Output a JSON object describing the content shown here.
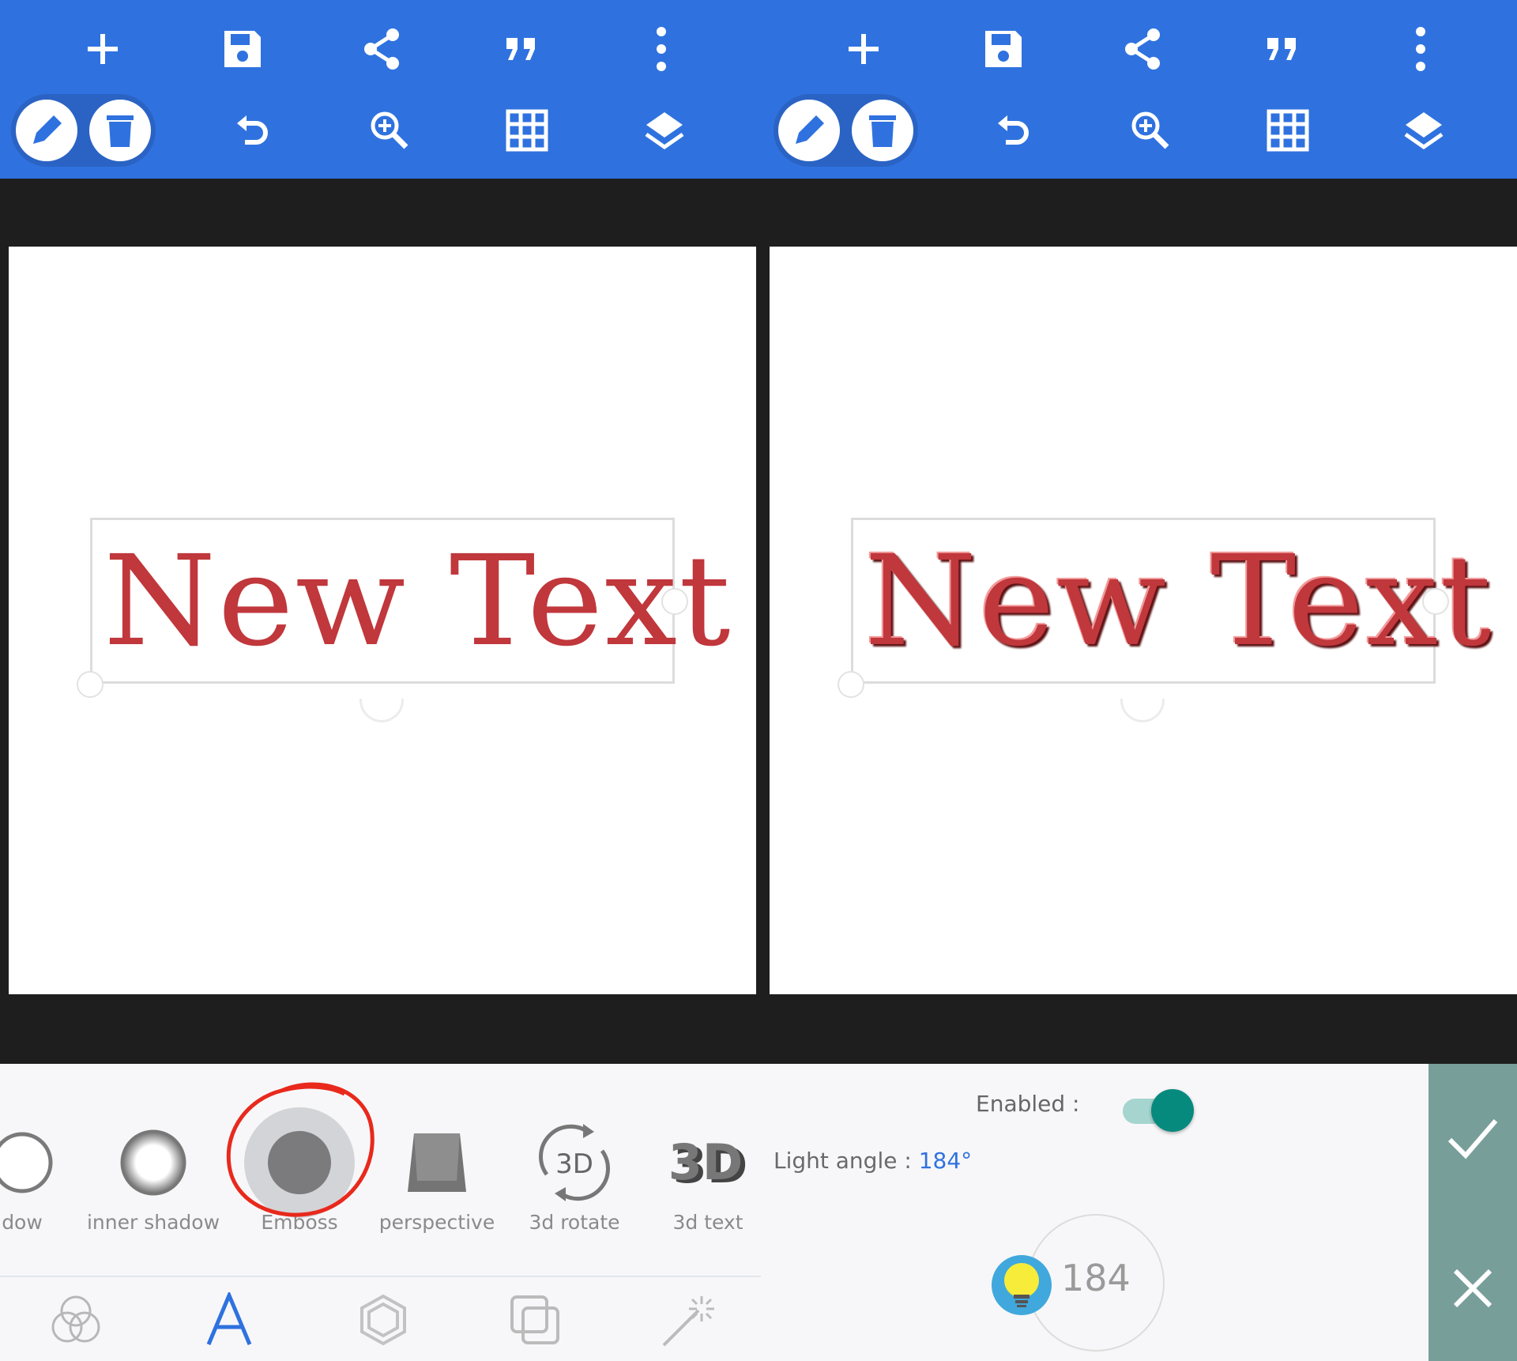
{
  "canvas": {
    "text": "New Text"
  },
  "left": {
    "effects": [
      {
        "label": "dow",
        "icon": "shadow-icon"
      },
      {
        "label": "inner shadow",
        "icon": "inner-shadow-icon"
      },
      {
        "label": "Emboss",
        "icon": "emboss-icon",
        "selected": true
      },
      {
        "label": "perspective",
        "icon": "perspective-icon"
      },
      {
        "label": "3d rotate",
        "icon": "3d-rotate-icon",
        "glyph": "3D"
      },
      {
        "label": "3d text",
        "icon": "3d-text-icon",
        "glyph": "3D"
      }
    ],
    "tabs": [
      "blend-icon",
      "text-icon",
      "shape-icon",
      "layers-duplicate-icon",
      "magic-wand-icon"
    ],
    "active_tab": "text-icon"
  },
  "right": {
    "enabled_label": "Enabled :",
    "enabled": true,
    "light_angle_label": "Light angle : ",
    "light_angle_value": "184°",
    "dial_value": "184"
  },
  "colors": {
    "toolbar": "#2f72df",
    "text": "#c0373c",
    "highlight_circle": "#e8291c",
    "toggle_on": "#078a7e",
    "side_panel": "#789e9a"
  }
}
